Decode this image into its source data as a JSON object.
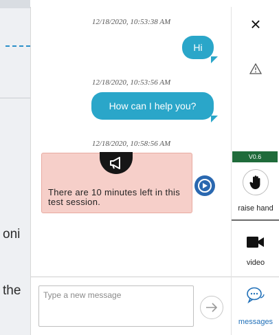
{
  "background": {
    "partial_text_1": "oni",
    "partial_text_2": "the"
  },
  "chat": {
    "messages": [
      {
        "timestamp": "12/18/2020, 10:53:38 AM",
        "text": "Hi"
      },
      {
        "timestamp": "12/18/2020, 10:53:56 AM",
        "text": "How can I help you?"
      },
      {
        "timestamp": "12/18/2020, 10:58:56 AM",
        "text": "There are 10 minutes left in this test session.",
        "kind": "alert",
        "icon": "megaphone-icon"
      }
    ],
    "input": {
      "placeholder": "Type a new message",
      "value": ""
    },
    "send_icon": "arrow-right-icon"
  },
  "toolbar": {
    "close_label": "×",
    "warning_icon": "warning-icon",
    "version": "V0.6",
    "raise_hand_label": "raise hand",
    "video_label": "video",
    "messages_label": "messages"
  },
  "colors": {
    "bubble": "#2aa6c9",
    "alert_bg": "#f6cfc9",
    "accent": "#2a68b0",
    "version_badge": "#1f6b3a"
  }
}
